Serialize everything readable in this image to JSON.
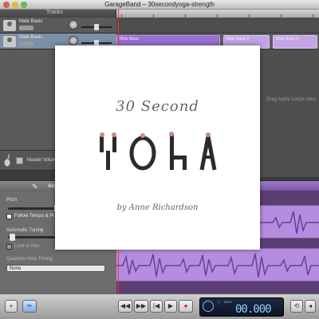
{
  "window": {
    "title": "GarageBand – 30secondyoga-strength"
  },
  "tracks_header": {
    "label": "Tracks"
  },
  "tracks": [
    {
      "name": "Male Basic"
    },
    {
      "name": "Male Basic"
    }
  ],
  "regions": [
    {
      "label": "Male Basic"
    },
    {
      "label": "Male Basic.2"
    },
    {
      "label": "Male Basic.4"
    }
  ],
  "drag_hint": "Drag Apple Loops here.",
  "master": {
    "label": "Master Volume"
  },
  "editor_panel": {
    "title": "Au",
    "pitch_label": "Pitch",
    "follow_label": "Follow Tempo & Pi",
    "tuning_label": "Automatic Tuning",
    "limit_label": "Limit to Key",
    "quant_label": "Quantize Note Timing",
    "quant_value": "None"
  },
  "transport": {
    "lcd_small_1": "1",
    "lcd_small_2": "BEAT",
    "lcd_time": "00.000"
  },
  "cover": {
    "title": "30 Second",
    "yoga": "YOGA",
    "author": "by Anne Richardson"
  },
  "colors": {
    "region": "#9b6fd3",
    "selected_track": "#7b8fa6",
    "playhead": "#e33333"
  }
}
